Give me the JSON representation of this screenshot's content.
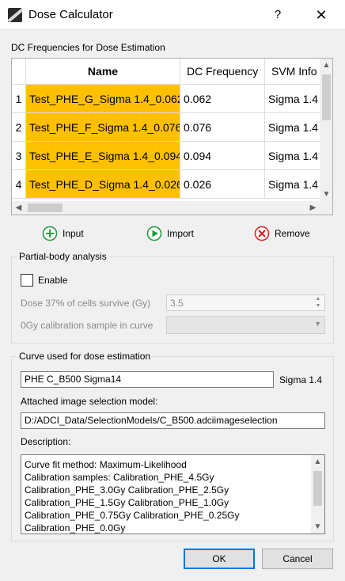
{
  "window": {
    "title": "Dose Calculator",
    "help_glyph": "?",
    "close_glyph": "✕"
  },
  "dc_section": {
    "label": "DC Frequencies for Dose Estimation",
    "columns": [
      "Name",
      "DC Frequency",
      "SVM Info"
    ],
    "rows": [
      {
        "num": "1",
        "name": "Test_PHE_G_Sigma 1.4_0.062",
        "freq": "0.062",
        "svm": "Sigma 1.4"
      },
      {
        "num": "2",
        "name": "Test_PHE_F_Sigma 1.4_0.076",
        "freq": "0.076",
        "svm": "Sigma 1.4"
      },
      {
        "num": "3",
        "name": "Test_PHE_E_Sigma 1.4_0.094",
        "freq": "0.094",
        "svm": "Sigma 1.4"
      },
      {
        "num": "4",
        "name": "Test_PHE_D_Sigma 1.4_0.026",
        "freq": "0.026",
        "svm": "Sigma 1.4"
      }
    ],
    "highlight_color": "#ffc000"
  },
  "actions": {
    "input_label": "Input",
    "import_label": "Import",
    "remove_label": "Remove",
    "input_icon": "plus-circle-icon",
    "import_icon": "play-circle-icon",
    "remove_icon": "x-circle-icon"
  },
  "partial_body": {
    "title": "Partial-body analysis",
    "enable_label": "Enable",
    "enabled": false,
    "dose_label": "Dose 37% of cells survive (Gy)",
    "dose_value": "3.5",
    "calib_label": "0Gy calibration sample in curve",
    "calib_value": ""
  },
  "curve": {
    "title": "Curve used for dose estimation",
    "curve_name": "PHE C_B500 Sigma14",
    "sigma_label": "Sigma 1.4",
    "model_label": "Attached image selection model:",
    "model_path": "D:/ADCI_Data/SelectionModels/C_B500.adciimageselection",
    "description_label": "Description:",
    "description_lines": [
      "Curve fit method: Maximum-Likelihood",
      "Calibration samples: Calibration_PHE_4.5Gy",
      "Calibration_PHE_3.0Gy Calibration_PHE_2.5Gy",
      "Calibration_PHE_1.5Gy Calibration_PHE_1.0Gy",
      "Calibration_PHE_0.75Gy Calibration_PHE_0.25Gy",
      "Calibration_PHE_0.0Gy"
    ]
  },
  "footer": {
    "ok_label": "OK",
    "cancel_label": "Cancel"
  },
  "colors": {
    "accent": "#0078d7",
    "add_green": "#1e9e3e",
    "remove_red": "#d92323"
  }
}
